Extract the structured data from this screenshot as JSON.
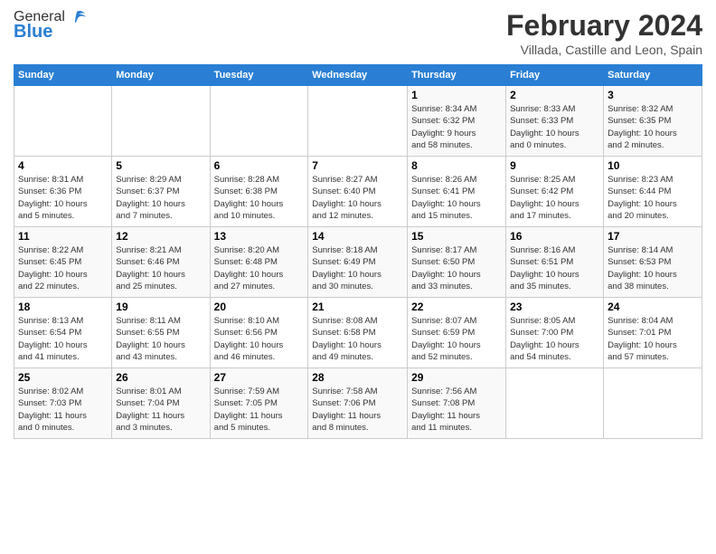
{
  "header": {
    "logo_line1": "General",
    "logo_line2": "Blue",
    "month_title": "February 2024",
    "location": "Villada, Castille and Leon, Spain"
  },
  "columns": [
    "Sunday",
    "Monday",
    "Tuesday",
    "Wednesday",
    "Thursday",
    "Friday",
    "Saturday"
  ],
  "weeks": [
    [
      {
        "day": "",
        "info": ""
      },
      {
        "day": "",
        "info": ""
      },
      {
        "day": "",
        "info": ""
      },
      {
        "day": "",
        "info": ""
      },
      {
        "day": "1",
        "info": "Sunrise: 8:34 AM\nSunset: 6:32 PM\nDaylight: 9 hours\nand 58 minutes."
      },
      {
        "day": "2",
        "info": "Sunrise: 8:33 AM\nSunset: 6:33 PM\nDaylight: 10 hours\nand 0 minutes."
      },
      {
        "day": "3",
        "info": "Sunrise: 8:32 AM\nSunset: 6:35 PM\nDaylight: 10 hours\nand 2 minutes."
      }
    ],
    [
      {
        "day": "4",
        "info": "Sunrise: 8:31 AM\nSunset: 6:36 PM\nDaylight: 10 hours\nand 5 minutes."
      },
      {
        "day": "5",
        "info": "Sunrise: 8:29 AM\nSunset: 6:37 PM\nDaylight: 10 hours\nand 7 minutes."
      },
      {
        "day": "6",
        "info": "Sunrise: 8:28 AM\nSunset: 6:38 PM\nDaylight: 10 hours\nand 10 minutes."
      },
      {
        "day": "7",
        "info": "Sunrise: 8:27 AM\nSunset: 6:40 PM\nDaylight: 10 hours\nand 12 minutes."
      },
      {
        "day": "8",
        "info": "Sunrise: 8:26 AM\nSunset: 6:41 PM\nDaylight: 10 hours\nand 15 minutes."
      },
      {
        "day": "9",
        "info": "Sunrise: 8:25 AM\nSunset: 6:42 PM\nDaylight: 10 hours\nand 17 minutes."
      },
      {
        "day": "10",
        "info": "Sunrise: 8:23 AM\nSunset: 6:44 PM\nDaylight: 10 hours\nand 20 minutes."
      }
    ],
    [
      {
        "day": "11",
        "info": "Sunrise: 8:22 AM\nSunset: 6:45 PM\nDaylight: 10 hours\nand 22 minutes."
      },
      {
        "day": "12",
        "info": "Sunrise: 8:21 AM\nSunset: 6:46 PM\nDaylight: 10 hours\nand 25 minutes."
      },
      {
        "day": "13",
        "info": "Sunrise: 8:20 AM\nSunset: 6:48 PM\nDaylight: 10 hours\nand 27 minutes."
      },
      {
        "day": "14",
        "info": "Sunrise: 8:18 AM\nSunset: 6:49 PM\nDaylight: 10 hours\nand 30 minutes."
      },
      {
        "day": "15",
        "info": "Sunrise: 8:17 AM\nSunset: 6:50 PM\nDaylight: 10 hours\nand 33 minutes."
      },
      {
        "day": "16",
        "info": "Sunrise: 8:16 AM\nSunset: 6:51 PM\nDaylight: 10 hours\nand 35 minutes."
      },
      {
        "day": "17",
        "info": "Sunrise: 8:14 AM\nSunset: 6:53 PM\nDaylight: 10 hours\nand 38 minutes."
      }
    ],
    [
      {
        "day": "18",
        "info": "Sunrise: 8:13 AM\nSunset: 6:54 PM\nDaylight: 10 hours\nand 41 minutes."
      },
      {
        "day": "19",
        "info": "Sunrise: 8:11 AM\nSunset: 6:55 PM\nDaylight: 10 hours\nand 43 minutes."
      },
      {
        "day": "20",
        "info": "Sunrise: 8:10 AM\nSunset: 6:56 PM\nDaylight: 10 hours\nand 46 minutes."
      },
      {
        "day": "21",
        "info": "Sunrise: 8:08 AM\nSunset: 6:58 PM\nDaylight: 10 hours\nand 49 minutes."
      },
      {
        "day": "22",
        "info": "Sunrise: 8:07 AM\nSunset: 6:59 PM\nDaylight: 10 hours\nand 52 minutes."
      },
      {
        "day": "23",
        "info": "Sunrise: 8:05 AM\nSunset: 7:00 PM\nDaylight: 10 hours\nand 54 minutes."
      },
      {
        "day": "24",
        "info": "Sunrise: 8:04 AM\nSunset: 7:01 PM\nDaylight: 10 hours\nand 57 minutes."
      }
    ],
    [
      {
        "day": "25",
        "info": "Sunrise: 8:02 AM\nSunset: 7:03 PM\nDaylight: 11 hours\nand 0 minutes."
      },
      {
        "day": "26",
        "info": "Sunrise: 8:01 AM\nSunset: 7:04 PM\nDaylight: 11 hours\nand 3 minutes."
      },
      {
        "day": "27",
        "info": "Sunrise: 7:59 AM\nSunset: 7:05 PM\nDaylight: 11 hours\nand 5 minutes."
      },
      {
        "day": "28",
        "info": "Sunrise: 7:58 AM\nSunset: 7:06 PM\nDaylight: 11 hours\nand 8 minutes."
      },
      {
        "day": "29",
        "info": "Sunrise: 7:56 AM\nSunset: 7:08 PM\nDaylight: 11 hours\nand 11 minutes."
      },
      {
        "day": "",
        "info": ""
      },
      {
        "day": "",
        "info": ""
      }
    ]
  ]
}
